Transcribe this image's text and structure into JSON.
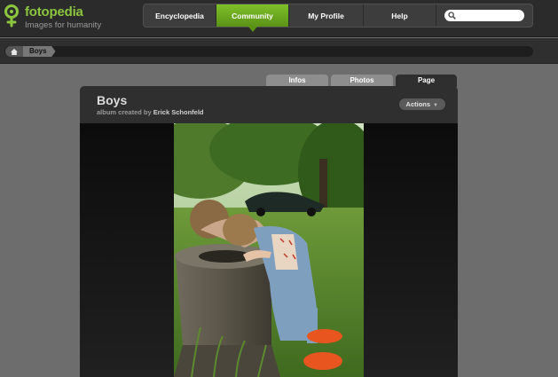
{
  "brand": {
    "name": "fotopedia",
    "tagline": "Images for humanity",
    "accent": "#8cc63f"
  },
  "nav": {
    "items": [
      {
        "label": "Encyclopedia",
        "active": false
      },
      {
        "label": "Community",
        "active": true
      },
      {
        "label": "My Profile",
        "active": false
      },
      {
        "label": "Help",
        "active": false
      }
    ],
    "search": {
      "placeholder": "",
      "value": "",
      "icon": "search-icon"
    }
  },
  "breadcrumb": {
    "home_icon": "home-icon",
    "current": "Boys"
  },
  "tabs": [
    {
      "label": "Infos",
      "active": false
    },
    {
      "label": "Photos",
      "active": false
    },
    {
      "label": "Page",
      "active": true
    }
  ],
  "album": {
    "title": "Boys",
    "created_by_prefix": "album created by",
    "author": "Erick Schonfeld",
    "actions_label": "Actions",
    "photo": {
      "subject": "two toddlers looking into a stone basin",
      "icon": "photo"
    }
  }
}
